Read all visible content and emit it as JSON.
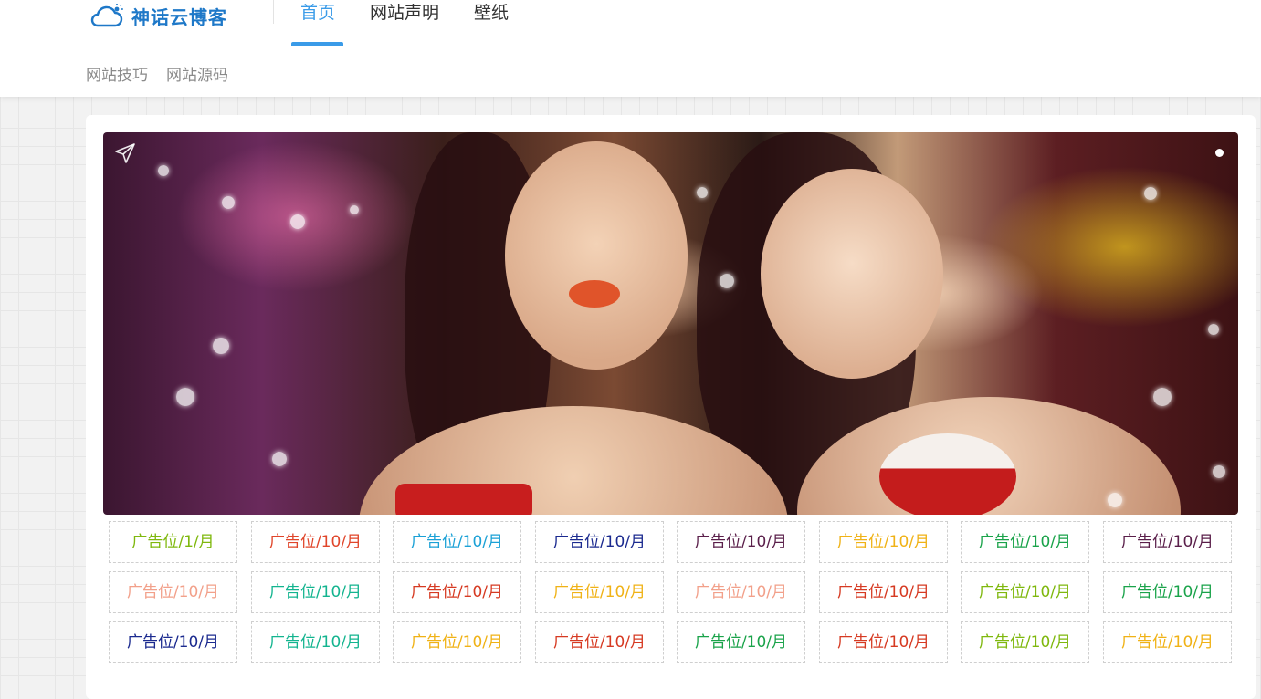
{
  "brand": {
    "name": "神话云博客",
    "color": "#1e78c8"
  },
  "nav": {
    "items": [
      {
        "label": "首页",
        "active": true
      },
      {
        "label": "网站声明",
        "active": false
      },
      {
        "label": "壁纸",
        "active": false
      }
    ],
    "accent": "#3a9be8"
  },
  "subnav": {
    "items": [
      {
        "label": "网站技巧"
      },
      {
        "label": "网站源码"
      }
    ]
  },
  "banner": {
    "icon": "paper-plane-icon",
    "slide_dots": 1
  },
  "ads": [
    {
      "label": "广告位/1/月",
      "color": "#7fb80e"
    },
    {
      "label": "广告位/10/月",
      "color": "#e0452a"
    },
    {
      "label": "广告位/10/月",
      "color": "#1ba1d6"
    },
    {
      "label": "广告位/10/月",
      "color": "#1b2a8f"
    },
    {
      "label": "广告位/10/月",
      "color": "#5a1f4a"
    },
    {
      "label": "广告位/10/月",
      "color": "#f0b216"
    },
    {
      "label": "广告位/10/月",
      "color": "#1aa34a"
    },
    {
      "label": "广告位/10/月",
      "color": "#5a1f4a"
    },
    {
      "label": "广告位/10/月",
      "color": "#f2a08a"
    },
    {
      "label": "广告位/10/月",
      "color": "#13b48f"
    },
    {
      "label": "广告位/10/月",
      "color": "#d63a22"
    },
    {
      "label": "广告位/10/月",
      "color": "#f0b216"
    },
    {
      "label": "广告位/10/月",
      "color": "#f2a08a"
    },
    {
      "label": "广告位/10/月",
      "color": "#d63a22"
    },
    {
      "label": "广告位/10/月",
      "color": "#7fb80e"
    },
    {
      "label": "广告位/10/月",
      "color": "#1aa34a"
    },
    {
      "label": "广告位/10/月",
      "color": "#1b2a8f"
    },
    {
      "label": "广告位/10/月",
      "color": "#13b48f"
    },
    {
      "label": "广告位/10/月",
      "color": "#f0b216"
    },
    {
      "label": "广告位/10/月",
      "color": "#d63a22"
    },
    {
      "label": "广告位/10/月",
      "color": "#1aa34a"
    },
    {
      "label": "广告位/10/月",
      "color": "#d63a22"
    },
    {
      "label": "广告位/10/月",
      "color": "#7fb80e"
    },
    {
      "label": "广告位/10/月",
      "color": "#f0b216"
    }
  ]
}
